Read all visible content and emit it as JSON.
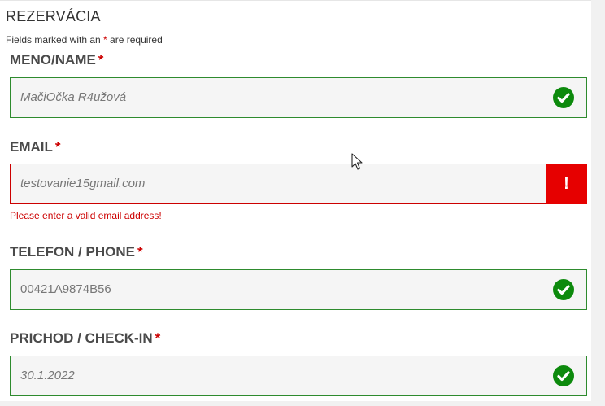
{
  "form": {
    "title": "REZERVÁCIA",
    "note_prefix": "Fields marked with an ",
    "note_star": "*",
    "note_suffix": " are required"
  },
  "fields": {
    "name": {
      "label": "MENO/NAME",
      "value": "MačiOčka R4užová",
      "state": "valid"
    },
    "email": {
      "label": "EMAIL",
      "value": "testovanie15gmail.com",
      "state": "invalid",
      "error_icon": "!",
      "error_message": "Please enter a valid email address!"
    },
    "phone": {
      "label": "TELEFON / PHONE",
      "value": "00421A9874B56",
      "state": "valid"
    },
    "checkin": {
      "label": "PRICHOD / CHECK-IN",
      "value": "30.1.2022",
      "state": "valid"
    }
  },
  "required_marker": "*",
  "colors": {
    "valid": "#0d8a0d",
    "invalid": "#e60000",
    "border_valid": "#2e8b2e"
  },
  "icons": {
    "valid": "checkmark-circle-icon",
    "invalid": "exclamation-icon",
    "cursor": "mouse-pointer-icon"
  }
}
